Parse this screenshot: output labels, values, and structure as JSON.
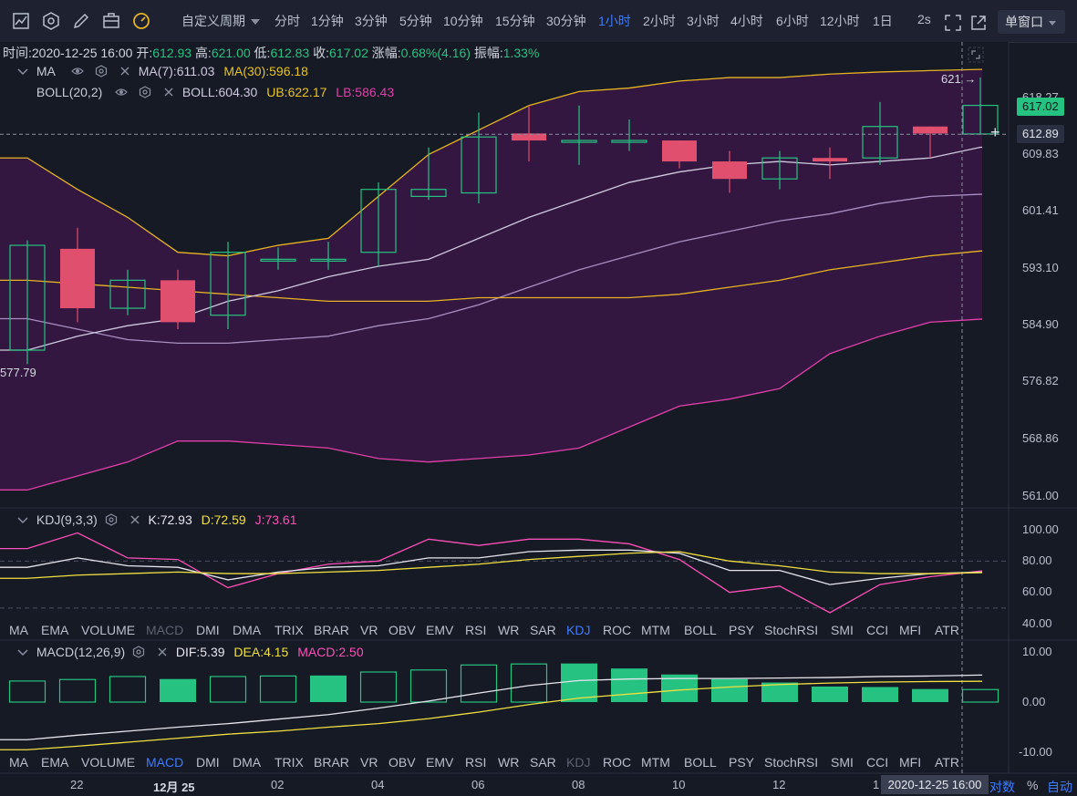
{
  "toolbar": {
    "icons": [
      "chart-icon",
      "settings-hex-icon",
      "pen-icon",
      "briefcase-icon",
      "gauge-icon"
    ],
    "period_select_label": "自定义周期",
    "periods": [
      "分时",
      "1分钟",
      "3分钟",
      "5分钟",
      "10分钟",
      "15分钟",
      "30分钟",
      "1小时",
      "2小时",
      "3小时",
      "4小时",
      "6小时",
      "12小时",
      "1日"
    ],
    "active_period": "1小时",
    "refresh_label": "2s",
    "window_label": "单窗口"
  },
  "info": {
    "time_label": "时间:",
    "time": "2020-12-25 16:00",
    "open_label": "开:",
    "open": "612.93",
    "high_label": "高:",
    "high": "621.00",
    "low_label": "低:",
    "low": "612.83",
    "close_label": "收:",
    "close": "617.02",
    "change_label": "涨幅:",
    "change": "0.68%(4.16)",
    "amp_label": "振幅:",
    "amp": "1.33%"
  },
  "legend_ma": {
    "name": "MA",
    "ma7": "MA(7):611.03",
    "ma30": "MA(30):596.18"
  },
  "legend_boll": {
    "name": "BOLL(20,2)",
    "boll": "BOLL:604.30",
    "ub": "UB:622.17",
    "lb": "LB:586.43"
  },
  "legend_kdj": {
    "name": "KDJ(9,3,3)",
    "k": "K:72.93",
    "d": "D:72.59",
    "j": "J:73.61"
  },
  "legend_macd": {
    "name": "MACD(12,26,9)",
    "dif": "DIF:5.39",
    "dea": "DEA:4.15",
    "macd": "MACD:2.50"
  },
  "indicator_tabs": [
    "MA",
    "EMA",
    "VOLUME",
    "MACD",
    "DMI",
    "DMA",
    "TRIX",
    "BRAR",
    "VR",
    "OBV",
    "EMV",
    "RSI",
    "WR",
    "SAR",
    "KDJ",
    "ROC",
    "MTM",
    "BOLL",
    "PSY",
    "StochRSI",
    "SMI",
    "CCI",
    "MFI",
    "ATR"
  ],
  "axis": {
    "price_ticks": [
      "618.27",
      "609.83",
      "601.41",
      "593.10",
      "584.90",
      "576.82",
      "568.86",
      "561.00"
    ],
    "kdj_ticks": [
      "100.00",
      "80.00",
      "60.00",
      "40.00"
    ],
    "macd_ticks": [
      "10.00",
      "0.00",
      "-10.00"
    ],
    "time_ticks": [
      "22",
      "12月 25",
      "02",
      "04",
      "06",
      "08",
      "10",
      "12",
      "1"
    ]
  },
  "price_tags": {
    "last": "617.02",
    "cursor": "612.89",
    "high_marker": "621",
    "low_marker": "577.79"
  },
  "crosshair_time": "2020-12-25 16:00",
  "bottom_buttons": {
    "log": "对数",
    "percent": "%",
    "auto": "自动"
  },
  "colors": {
    "up": "#26c281",
    "down": "#e0506e",
    "ma7": "#cfc9df",
    "ma30": "#e6b422",
    "boll_band": "#3a1747",
    "lb": "#e040a8",
    "k": "#e6e6ee",
    "d": "#f0e040",
    "j": "#ff4fb8",
    "accent": "#3d7cff"
  },
  "chart_data": {
    "type": "candlestick",
    "y_range": [
      561,
      624
    ],
    "candles": [
      {
        "o": 582.0,
        "h": 597.7,
        "l": 580.0,
        "c": 597.0
      },
      {
        "o": 596.5,
        "h": 599.5,
        "l": 586.0,
        "c": 588.0
      },
      {
        "o": 588.0,
        "h": 593.5,
        "l": 587.0,
        "c": 592.0
      },
      {
        "o": 592.0,
        "h": 593.5,
        "l": 585.0,
        "c": 586.0
      },
      {
        "o": 587.0,
        "h": 597.5,
        "l": 585.0,
        "c": 596.0
      },
      {
        "o": 595.0,
        "h": 596.7,
        "l": 593.5,
        "c": 595.0
      },
      {
        "o": 595.0,
        "h": 597.5,
        "l": 593.5,
        "c": 595.0
      },
      {
        "o": 596.0,
        "h": 606.0,
        "l": 594.0,
        "c": 605.0
      },
      {
        "o": 604.0,
        "h": 611.0,
        "l": 603.5,
        "c": 605.0
      },
      {
        "o": 604.5,
        "h": 616.0,
        "l": 603.0,
        "c": 612.5
      },
      {
        "o": 613.0,
        "h": 617.0,
        "l": 609.0,
        "c": 612.0
      },
      {
        "o": 612.0,
        "h": 617.0,
        "l": 608.5,
        "c": 612.0
      },
      {
        "o": 612.0,
        "h": 615.0,
        "l": 610.5,
        "c": 612.0
      },
      {
        "o": 612.0,
        "h": 612.0,
        "l": 608.0,
        "c": 609.0
      },
      {
        "o": 609.0,
        "h": 610.5,
        "l": 604.5,
        "c": 606.5
      },
      {
        "o": 606.5,
        "h": 610.5,
        "l": 605.0,
        "c": 609.5
      },
      {
        "o": 609.5,
        "h": 611.0,
        "l": 606.5,
        "c": 609.0
      },
      {
        "o": 609.5,
        "h": 617.5,
        "l": 608.5,
        "c": 614.0
      },
      {
        "o": 614.0,
        "h": 614.0,
        "l": 609.5,
        "c": 613.0
      },
      {
        "o": 612.93,
        "h": 621.0,
        "l": 612.83,
        "c": 617.02
      }
    ],
    "ma7": [
      582.0,
      584.0,
      585.5,
      586.5,
      589.0,
      590.5,
      592.5,
      594.0,
      595.0,
      598.0,
      601.0,
      603.5,
      606.0,
      607.5,
      608.5,
      609.0,
      608.5,
      609.0,
      609.5,
      611.03
    ],
    "ma30": [
      592.0,
      591.5,
      591.0,
      590.5,
      590.0,
      589.5,
      589.0,
      589.0,
      589.0,
      589.5,
      589.5,
      589.5,
      589.5,
      590.0,
      591.0,
      592.0,
      593.5,
      594.5,
      595.5,
      596.18
    ],
    "boll_mid": [
      586.5,
      585.0,
      583.5,
      583.0,
      583.0,
      583.5,
      584.0,
      585.5,
      586.5,
      588.5,
      591.0,
      593.5,
      595.5,
      597.5,
      599.0,
      600.5,
      601.5,
      603.0,
      604.0,
      604.3
    ],
    "boll_ub": [
      609.5,
      605.0,
      601.0,
      596.0,
      595.5,
      597.0,
      598.0,
      604.0,
      610.0,
      613.5,
      617.0,
      619.0,
      619.5,
      620.5,
      621.0,
      621.0,
      621.5,
      621.8,
      622.0,
      622.17
    ],
    "boll_lb": [
      562.0,
      564.0,
      566.0,
      569.0,
      569.0,
      568.5,
      568.0,
      566.5,
      566.0,
      566.5,
      567.0,
      568.0,
      571.0,
      574.0,
      575.0,
      576.5,
      581.5,
      584.0,
      586.0,
      586.43
    ],
    "kdj_range": [
      40,
      100
    ],
    "k": [
      76,
      82,
      77,
      76,
      68,
      73,
      76,
      77,
      82,
      82,
      86,
      87,
      87,
      85,
      74,
      74,
      65,
      69,
      72,
      72.93
    ],
    "d": [
      69,
      71,
      72,
      73,
      72,
      72,
      73,
      74,
      76,
      78,
      81,
      83,
      85,
      86,
      80,
      77,
      73,
      72,
      72,
      72.59
    ],
    "j": [
      88,
      98,
      82,
      81,
      63,
      72,
      78,
      80,
      94,
      90,
      94,
      94,
      91,
      81,
      60,
      64,
      47,
      65,
      70,
      73.61
    ],
    "macd_range": [
      -12,
      12
    ],
    "macd_hist": [
      4.2,
      4.5,
      5.1,
      4.6,
      5.1,
      5.2,
      5.3,
      6.0,
      6.4,
      7.4,
      7.6,
      7.7,
      6.7,
      5.5,
      4.6,
      3.9,
      3.1,
      3.0,
      2.6,
      2.5
    ],
    "macd_hist_filled": [
      false,
      false,
      false,
      true,
      false,
      false,
      true,
      false,
      false,
      false,
      false,
      true,
      true,
      true,
      true,
      true,
      true,
      true,
      true,
      false
    ],
    "dif": [
      -7.5,
      -6.6,
      -5.8,
      -5.0,
      -4.3,
      -3.4,
      -2.5,
      -1.2,
      0.2,
      1.8,
      3.3,
      4.3,
      4.6,
      4.7,
      4.7,
      4.8,
      4.9,
      5.1,
      5.2,
      5.39
    ],
    "dea": [
      -9.5,
      -8.8,
      -8.0,
      -7.2,
      -6.4,
      -5.8,
      -5.0,
      -4.3,
      -3.3,
      -2.0,
      -0.5,
      0.8,
      1.6,
      2.4,
      3.0,
      3.5,
      3.8,
      4.0,
      4.1,
      4.15
    ]
  }
}
